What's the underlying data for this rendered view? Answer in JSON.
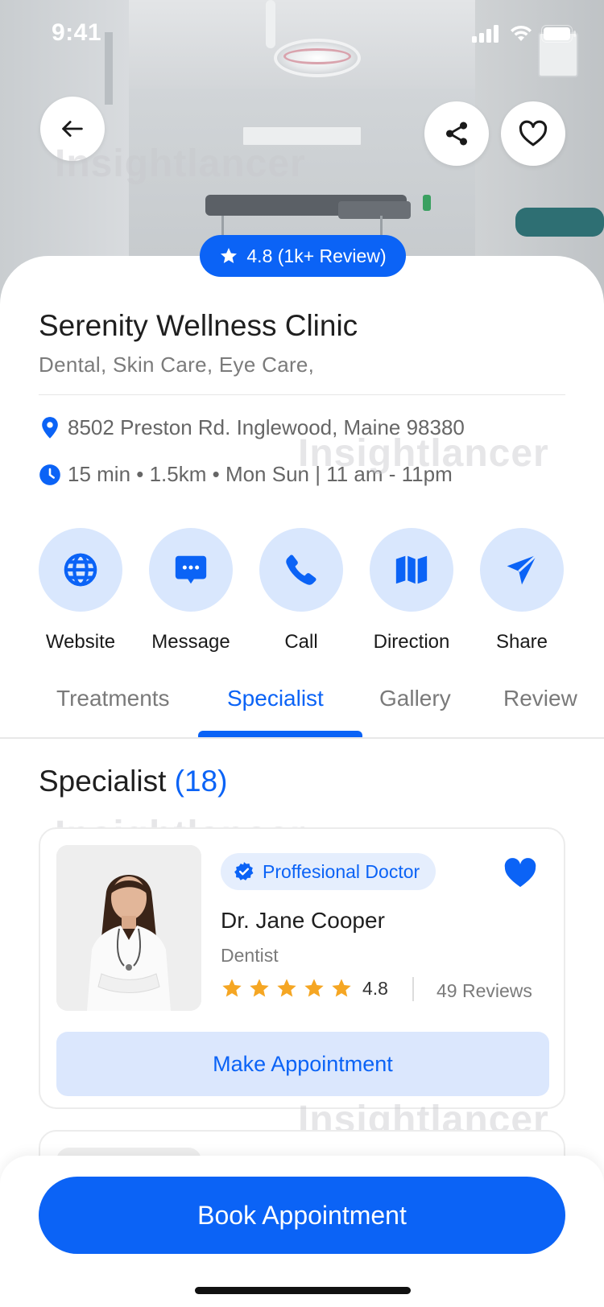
{
  "status_bar": {
    "time": "9:41"
  },
  "header": {
    "icons": {
      "back": "arrow-left-icon",
      "share": "share-icon",
      "favorite": "heart-outline-icon"
    }
  },
  "watermark": "Insightlancer",
  "rating_pill": {
    "text": "4.8 (1k+ Review)",
    "icon": "star-icon"
  },
  "clinic": {
    "name": "Serenity Wellness Clinic",
    "categories": "Dental, Skin Care, Eye Care,",
    "address": "8502 Preston Rd. Inglewood, Maine 98380",
    "hours": "15 min • 1.5km • Mon Sun | 11 am - 11pm"
  },
  "actions": [
    {
      "label": "Website",
      "icon": "globe-icon"
    },
    {
      "label": "Message",
      "icon": "chat-icon"
    },
    {
      "label": "Call",
      "icon": "phone-icon"
    },
    {
      "label": "Direction",
      "icon": "map-icon"
    },
    {
      "label": "Share",
      "icon": "send-icon"
    }
  ],
  "tabs": [
    {
      "label": "Treatments",
      "active": false
    },
    {
      "label": "Specialist",
      "active": true
    },
    {
      "label": "Gallery",
      "active": false
    },
    {
      "label": "Review",
      "active": false
    }
  ],
  "section": {
    "title": "Specialist",
    "count": "(18)"
  },
  "specialist": {
    "badge": "Proffesional Doctor",
    "name": "Dr. Jane Cooper",
    "specialty": "Dentist",
    "rating": "4.8",
    "stars": 5,
    "reviews": "49 Reviews",
    "appointment_label": "Make Appointment"
  },
  "book_button": "Book Appointment",
  "colors": {
    "primary": "#0b63f6",
    "primary_light": "#d9e7fd",
    "star": "#f5a623"
  }
}
